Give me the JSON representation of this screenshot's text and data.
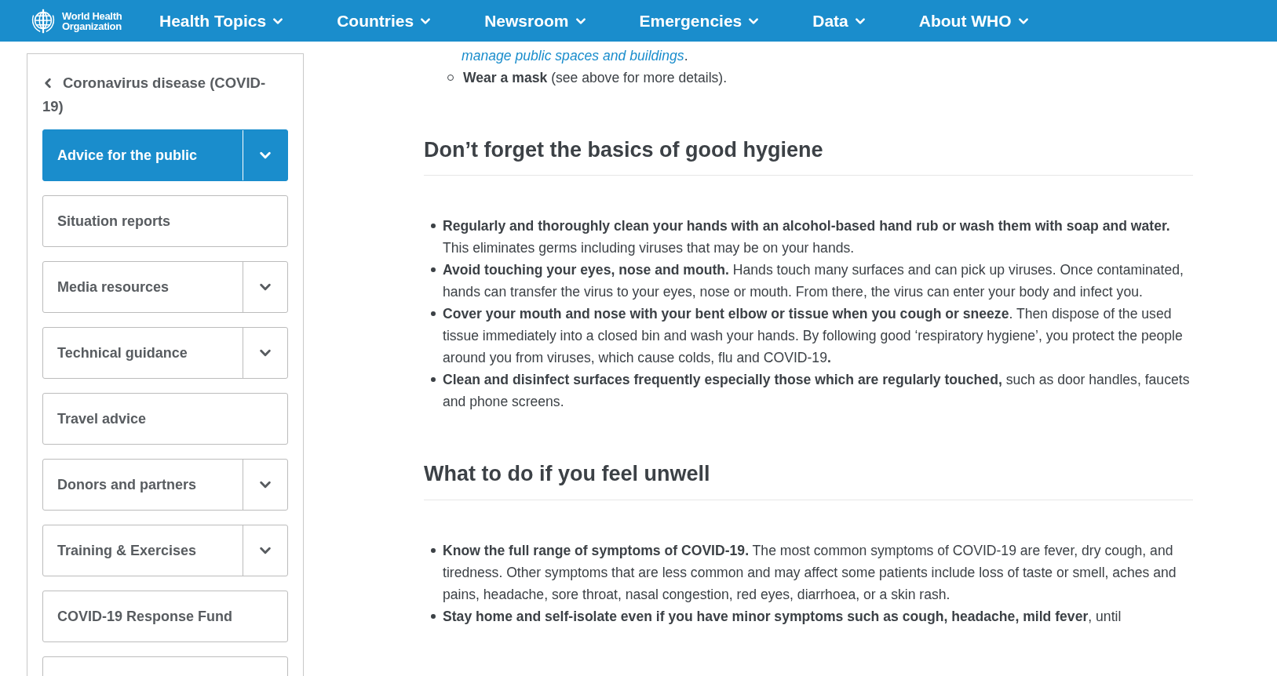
{
  "header": {
    "logo_text": "World Health Organization",
    "menu": [
      {
        "label": "Health Topics"
      },
      {
        "label": "Countries"
      },
      {
        "label": "Newsroom"
      },
      {
        "label": "Emergencies"
      },
      {
        "label": "Data"
      },
      {
        "label": "About WHO"
      }
    ]
  },
  "sidebar": {
    "back_label": "Coronavirus disease (COVID-19)",
    "items": [
      {
        "label": "Advice for the public",
        "has_dropdown": true,
        "selected": true
      },
      {
        "label": "Situation reports",
        "has_dropdown": false,
        "selected": false
      },
      {
        "label": "Media resources",
        "has_dropdown": true,
        "selected": false
      },
      {
        "label": "Technical guidance",
        "has_dropdown": true,
        "selected": false
      },
      {
        "label": "Travel advice",
        "has_dropdown": false,
        "selected": false
      },
      {
        "label": "Donors and partners",
        "has_dropdown": true,
        "selected": false
      },
      {
        "label": "Training & Exercises",
        "has_dropdown": true,
        "selected": false
      },
      {
        "label": "COVID-19 Response Fund",
        "has_dropdown": false,
        "selected": false
      },
      {
        "has_dropdown": false,
        "selected": false
      }
    ]
  },
  "article": {
    "cut_line": {
      "link": "manage public spaces and buildings",
      "after": "."
    },
    "sub_items": [
      "**Wear a mask** (see above for more details)."
    ],
    "sections": [
      {
        "heading": "Don’t forget the basics of good hygiene",
        "items": [
          "**Regularly and thoroughly clean your hands with an alcohol-based hand rub or wash them with soap and water.** This eliminates germs including viruses that may be on your hands.",
          "**Avoid touching your eyes, nose and mouth.** Hands touch many surfaces and can pick up viruses. Once contaminated, hands can transfer the virus to your eyes, nose or mouth. From there, the virus can enter your body and infect you.",
          "**Cover your mouth and nose with your bent elbow or tissue when you cough or sneeze**. Then dispose of the used tissue immediately into a closed bin and wash your hands. By following good ‘respiratory hygiene’, you protect the people around you from viruses, which cause colds, flu and COVID-19**.**",
          "**Clean and disinfect surfaces frequently especially those which are regularly touched,** such as door handles, faucets and phone screens."
        ]
      },
      {
        "heading": "What to do if you feel unwell",
        "items": [
          "**Know the full range of symptoms of COVID-19.** The most common symptoms of COVID-19 are fever, dry cough, and tiredness. Other symptoms that are less common and may affect some patients include loss of taste or smell, aches and pains, headache, sore throat, nasal congestion, red eyes, diarrhoea, or a skin rash.",
          "**Stay home and self-isolate even if you have minor symptoms such as cough, headache, mild fever**, until"
        ]
      }
    ]
  }
}
